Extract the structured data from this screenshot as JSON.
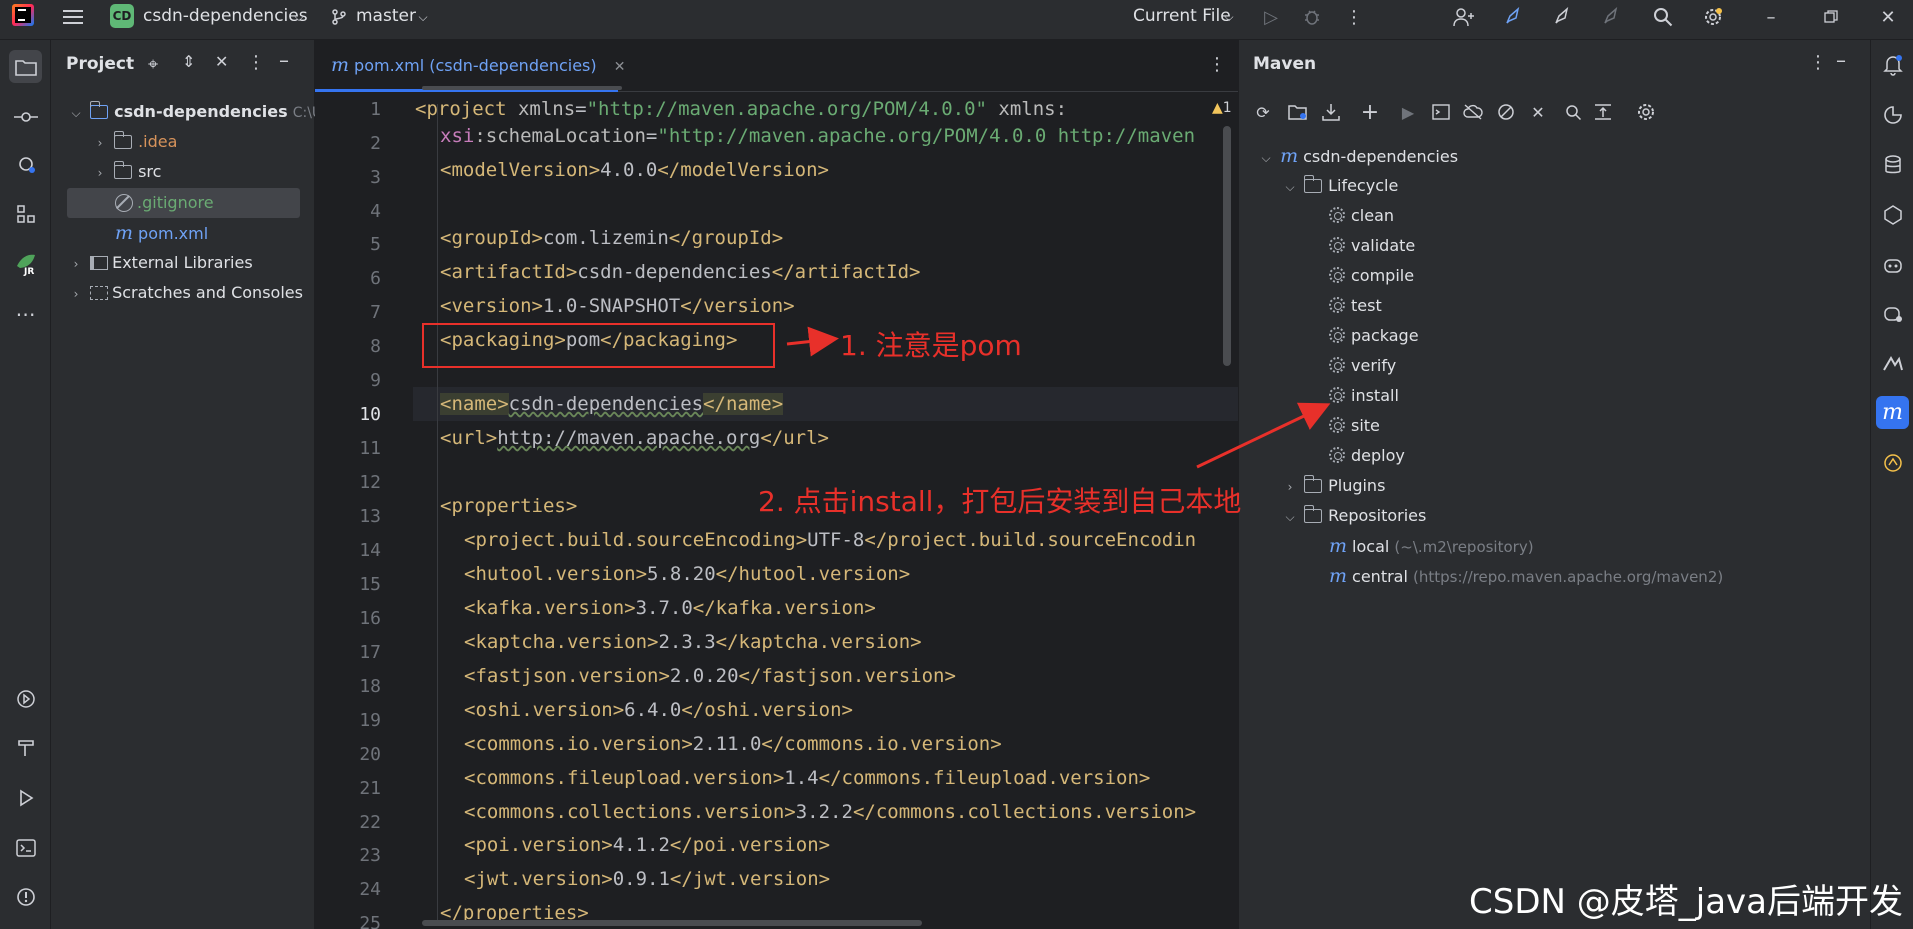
{
  "titlebar": {
    "app_icon": "intellij-logo-icon",
    "project_badge": "CD",
    "project_name": "csdn-dependencies",
    "branch": "master",
    "run_config": "Current File"
  },
  "project_panel": {
    "title": "Project",
    "root": {
      "name": "csdn-dependencies",
      "path_hint": "C:\\Use"
    },
    "items": [
      {
        "label": ".idea",
        "color": "#d7935b"
      },
      {
        "label": "src",
        "color": "#dfe1e5"
      },
      {
        "label": ".gitignore",
        "color": "#6aab73"
      },
      {
        "label": "pom.xml",
        "color": "#6fa2f5"
      }
    ],
    "external_libraries": "External Libraries",
    "scratches": "Scratches and Consoles"
  },
  "editor": {
    "tab_label": "pom.xml (csdn-dependencies)",
    "inspection": {
      "warnings": "1",
      "ok": "1"
    },
    "current_line": 10,
    "line_numbers": [
      "1",
      "2",
      "3",
      "4",
      "5",
      "6",
      "7",
      "8",
      "9",
      "10",
      "11",
      "12",
      "13",
      "14",
      "15",
      "16",
      "17",
      "18",
      "19",
      "20",
      "21",
      "22",
      "23",
      "24",
      "25"
    ],
    "lines": {
      "l1_tag": "<project",
      "l1_attr": " xmlns",
      "l1_eq": "=",
      "l1_val": "\"http://maven.apache.org/POM/4.0.0\"",
      "l1_attr2": " xmlns:",
      "l2_ns": "xsi",
      "l2_attr": ":schemaLocation",
      "l2_eq": "=",
      "l2_val": "\"http://maven.apache.org/POM/4.0.0 http://maven",
      "l3_open": "<modelVersion>",
      "l3_text": "4.0.0",
      "l3_close": "</modelVersion>",
      "l5_open": "<groupId>",
      "l5_text": "com.lizemin",
      "l5_close": "</groupId>",
      "l6_open": "<artifactId>",
      "l6_text": "csdn-dependencies",
      "l6_close": "</artifactId>",
      "l7_open": "<version>",
      "l7_text": "1.0-SNAPSHOT",
      "l7_close": "</version>",
      "l8_open": "<packaging>",
      "l8_text": "pom",
      "l8_close": "</packaging>",
      "l10_open": "<name>",
      "l10_text": "csdn-dependencies",
      "l10_close": "</name>",
      "l11_open": "<url>",
      "l11_text": "http://maven.apache.org",
      "l11_close": "</url>",
      "l13": "<properties>",
      "l14_open": "<project.build.sourceEncoding>",
      "l14_text": "UTF-8",
      "l14_close": "</project.build.sourceEncodin",
      "l15_open": "<hutool.version>",
      "l15_text": "5.8.20",
      "l15_close": "</hutool.version>",
      "l16_open": "<kafka.version>",
      "l16_text": "3.7.0",
      "l16_close": "</kafka.version>",
      "l17_open": "<kaptcha.version>",
      "l17_text": "2.3.3",
      "l17_close": "</kaptcha.version>",
      "l18_open": "<fastjson.version>",
      "l18_text": "2.0.20",
      "l18_close": "</fastjson.version>",
      "l19_open": "<oshi.version>",
      "l19_text": "6.4.0",
      "l19_close": "</oshi.version>",
      "l20_open": "<commons.io.version>",
      "l20_text": "2.11.0",
      "l20_close": "</commons.io.version>",
      "l21_open": "<commons.fileupload.version>",
      "l21_text": "1.4",
      "l21_close": "</commons.fileupload.version>",
      "l22_open": "<commons.collections.version>",
      "l22_text": "3.2.2",
      "l22_close": "</commons.collections.version>",
      "l23_open": "<poi.version>",
      "l23_text": "4.1.2",
      "l23_close": "</poi.version>",
      "l24_open": "<jwt.version>",
      "l24_text": "0.9.1",
      "l24_close": "</jwt.version>",
      "l25": "</properties>"
    }
  },
  "maven_panel": {
    "title": "Maven",
    "root": "csdn-dependencies",
    "lifecycle_label": "Lifecycle",
    "lifecycle": [
      "clean",
      "validate",
      "compile",
      "test",
      "package",
      "verify",
      "install",
      "site",
      "deploy"
    ],
    "plugins_label": "Plugins",
    "repositories_label": "Repositories",
    "repositories": [
      {
        "name": "local",
        "hint": "(~\\.m2\\repository)"
      },
      {
        "name": "central",
        "hint": "(https://repo.maven.apache.org/maven2)"
      }
    ]
  },
  "annotations": {
    "note1": "1. 注意是pom",
    "note2": "2. 点击install，打包后安装到自己本地",
    "color": "#e8302a"
  },
  "watermark": "CSDN @皮塔_java后端开发"
}
